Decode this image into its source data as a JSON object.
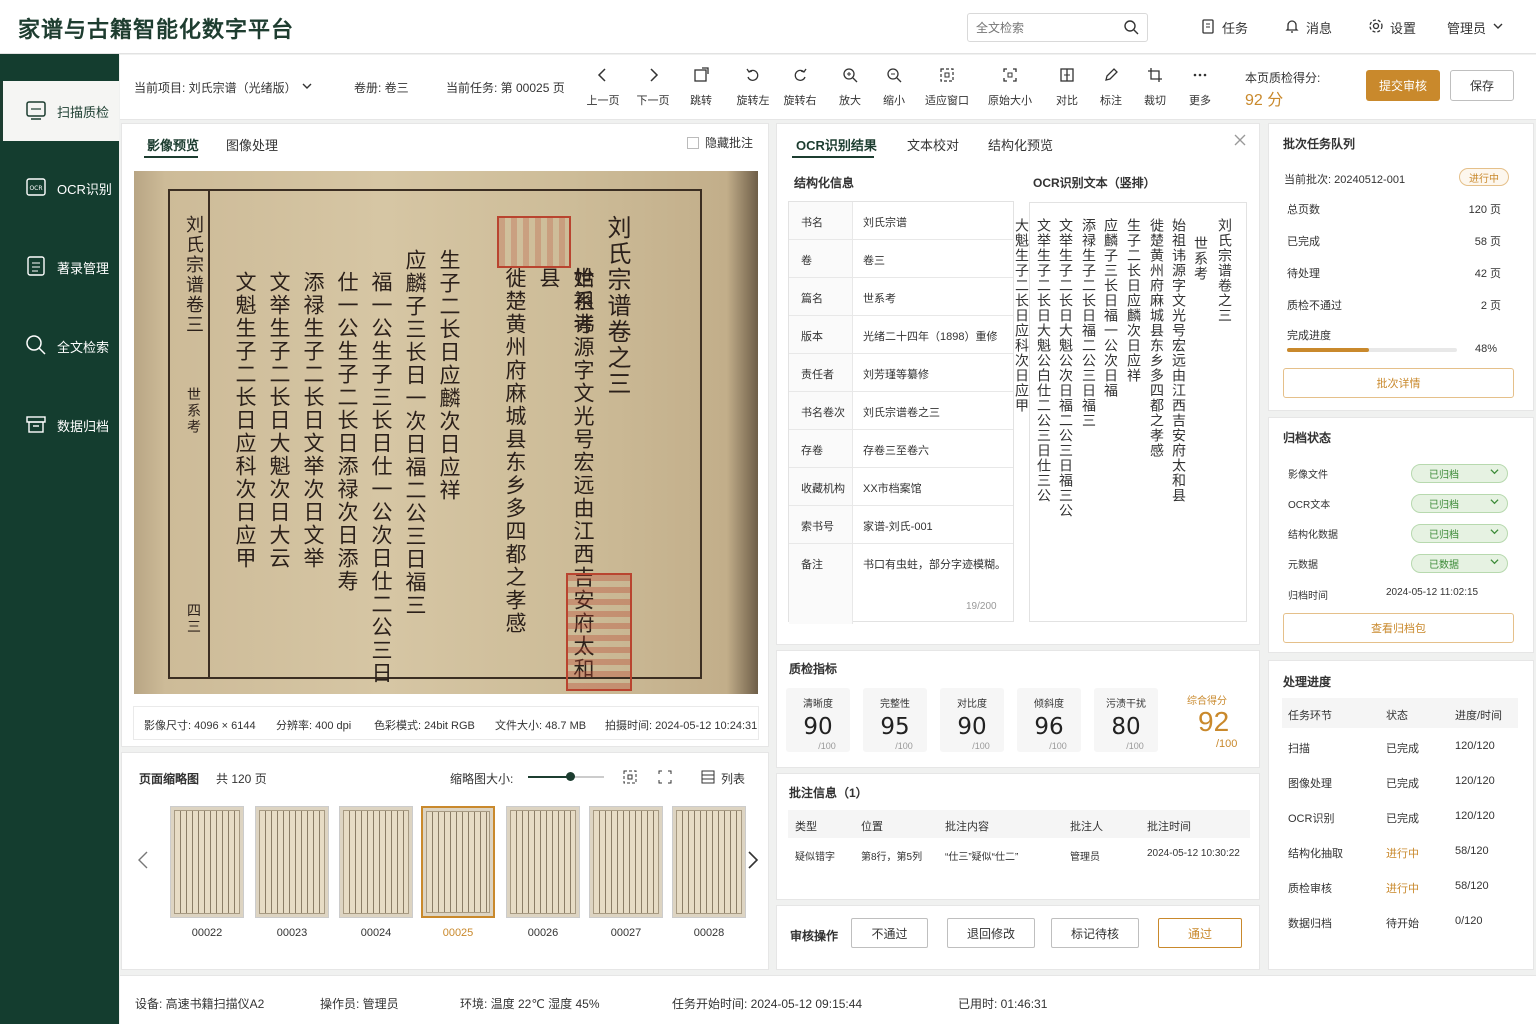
{
  "app": {
    "title": "家谱与古籍智能化数字平台"
  },
  "header": {
    "search_placeholder": "全文检索",
    "nav": [
      {
        "icon": "clipboard-icon",
        "label": "任务"
      },
      {
        "icon": "bell-icon",
        "label": "消息"
      },
      {
        "icon": "gear-icon",
        "label": "设置"
      }
    ],
    "user": "管理员"
  },
  "sidebar": {
    "items": [
      {
        "label": "扫描质检",
        "icon": "scan-icon",
        "active": true
      },
      {
        "label": "OCR识别",
        "icon": "ocr-icon",
        "active": false
      },
      {
        "label": "著录管理",
        "icon": "document-list-icon",
        "active": false
      },
      {
        "label": "全文检索",
        "icon": "search-icon",
        "active": false
      },
      {
        "label": "数据归档",
        "icon": "archive-box-icon",
        "active": false
      }
    ]
  },
  "toolbar": {
    "project_label": "当前项目: 刘氏宗谱（光绪版）",
    "volume_label": "卷册: 卷三",
    "task_label": "当前任务: 第 00025 页",
    "tools": [
      "上一页",
      "下一页",
      "跳转",
      "旋转左",
      "旋转右",
      "放大",
      "缩小",
      "适应窗口",
      "原始大小",
      "对比",
      "标注",
      "裁切",
      "更多"
    ],
    "score_label": "本页质检得分:",
    "score_value": "92 分",
    "submit_label": "提交审核",
    "save_label": "保存"
  },
  "viewer": {
    "tabs": [
      "影像预览",
      "图像处理"
    ],
    "hide_annotations": "隐藏批注",
    "scan_side_title": "刘氏宗谱卷三",
    "scan_side_sub": "世系考",
    "scan_page_no": "四三",
    "scan_columns": [
      "刘氏宗谱卷之三",
      "世系考",
      "始祖讳源字文光号宏远由江西吉安府太和县",
      "徙楚黄州府麻城县东乡多四都之孝感",
      "生子二长日应麟次日应祥",
      "应麟子三长日一次日福二公三日福三",
      "福一公生子三长日仕一公次日仕二公三日",
      "仕一公生子二长日添禄次日添寿",
      "添禄生子二长日文举次日文举",
      "文举生子二长日大魁次日大云",
      "文魁生子二长日应科次日应甲"
    ],
    "meta": {
      "size": "影像尺寸: 4096 × 6144",
      "dpi": "分辨率: 400 dpi",
      "color": "色彩模式: 24bit RGB",
      "filesize": "文件大小: 48.7 MB",
      "shot_time": "拍摄时间: 2024-05-12 10:24:31"
    },
    "thumbs_title": "页面缩略图",
    "thumbs_count": "共 120 页",
    "thumb_size_label": "缩略图大小:",
    "thumb_size_level": 0.55,
    "list_label": "列表",
    "thumbs": [
      "00022",
      "00023",
      "00024",
      "00025",
      "00026",
      "00027",
      "00028"
    ],
    "selected_thumb": "00025"
  },
  "ocr": {
    "tabs": [
      "OCR识别结果",
      "文本校对",
      "结构化预览"
    ],
    "struct_title": "结构化信息",
    "text_title": "OCR识别文本（竖排）",
    "fields": [
      {
        "k": "书名",
        "v": "刘氏宗谱"
      },
      {
        "k": "卷",
        "v": "卷三"
      },
      {
        "k": "篇名",
        "v": "世系考"
      },
      {
        "k": "版本",
        "v": "光绪二十四年（1898）重修"
      },
      {
        "k": "责任者",
        "v": "刘芳瑾等纂修"
      },
      {
        "k": "书名卷次",
        "v": "刘氏宗谱卷之三"
      },
      {
        "k": "存卷",
        "v": "存卷三至卷六"
      },
      {
        "k": "收藏机构",
        "v": "XX市档案馆"
      },
      {
        "k": "索书号",
        "v": "家谱-刘氏-001"
      },
      {
        "k": "备注",
        "v": "书口有虫蛀，部分字迹模糊。"
      }
    ],
    "note_counter": "19/200",
    "ocr_columns": [
      "刘氏宗谱卷之三",
      "世系考",
      "始祖讳源字文光号宏远由江西吉安府太和县",
      "徙楚黄州府麻城县东乡多四都之孝感",
      "生子二长日应麟次日应祥",
      "应麟子三长日福一公次日福",
      "添禄生子二长日福二公三日福三",
      "文举生子二长日大魁公次日福二公三日福三公",
      "文举生子二长日大魁公白仕二公三日仕三公",
      "大魁生子二长日应科次日应甲"
    ],
    "quality_title": "质检指标",
    "metrics": [
      {
        "k": "清晰度",
        "v": "90"
      },
      {
        "k": "完整性",
        "v": "95"
      },
      {
        "k": "对比度",
        "v": "90"
      },
      {
        "k": "倾斜度",
        "v": "96"
      },
      {
        "k": "污渍干扰",
        "v": "80"
      }
    ],
    "metric_unit": "/100",
    "overall_label": "综合得分",
    "overall_value": "92",
    "overall_unit": "/100",
    "annot_title": "批注信息（1）",
    "annot_headers": [
      "类型",
      "位置",
      "批注内容",
      "批注人",
      "批注时间"
    ],
    "annot_rows": [
      [
        "疑似错字",
        "第8行，第5列",
        "“仕三”疑似“仕二”",
        "管理员",
        "2024-05-12 10:30:22"
      ]
    ],
    "review_title": "审核操作",
    "review_buttons": [
      "不通过",
      "退回修改",
      "标记待核",
      "通过"
    ]
  },
  "right": {
    "queue_title": "批次任务队列",
    "batch_label": "当前批次: 20240512-001",
    "batch_status": "进行中",
    "stats": [
      {
        "k": "总页数",
        "v": "120 页"
      },
      {
        "k": "已完成",
        "v": "58 页"
      },
      {
        "k": "待处理",
        "v": "42 页"
      },
      {
        "k": "质检不通过",
        "v": "2 页"
      }
    ],
    "progress_label": "完成进度",
    "progress_value": "48%",
    "progress_fraction": 0.48,
    "batch_detail": "批次详情",
    "archive_title": "归档状态",
    "archive_rows": [
      {
        "k": "影像文件",
        "v": "已归档"
      },
      {
        "k": "OCR文本",
        "v": "已归档"
      },
      {
        "k": "结构化数据",
        "v": "已归档"
      },
      {
        "k": "元数据",
        "v": "已数据"
      }
    ],
    "archive_time_label": "归档时间",
    "archive_time": "2024-05-12 11:02:15",
    "archive_btn": "查看归档包",
    "progress_title": "处理进度",
    "progress_headers": [
      "任务环节",
      "状态",
      "进度/时间"
    ],
    "progress_rows": [
      [
        "扫描",
        "已完成",
        "120/120"
      ],
      [
        "图像处理",
        "已完成",
        "120/120"
      ],
      [
        "OCR识别",
        "已完成",
        "120/120"
      ],
      [
        "结构化抽取",
        "进行中",
        "58/120"
      ],
      [
        "质检审核",
        "进行中",
        "58/120"
      ],
      [
        "数据归档",
        "待开始",
        "0/120"
      ]
    ]
  },
  "status": {
    "device": "设备: 高速书籍扫描仪A2",
    "operator": "操作员: 管理员",
    "env": "环境: 温度 22℃   湿度 45%",
    "start": "任务开始时间: 2024-05-12 09:15:44",
    "elapsed": "已用时: 01:46:31"
  },
  "colors": {
    "brand": "#143d2f",
    "accent": "#c9892c",
    "success": "#3c8b38"
  }
}
